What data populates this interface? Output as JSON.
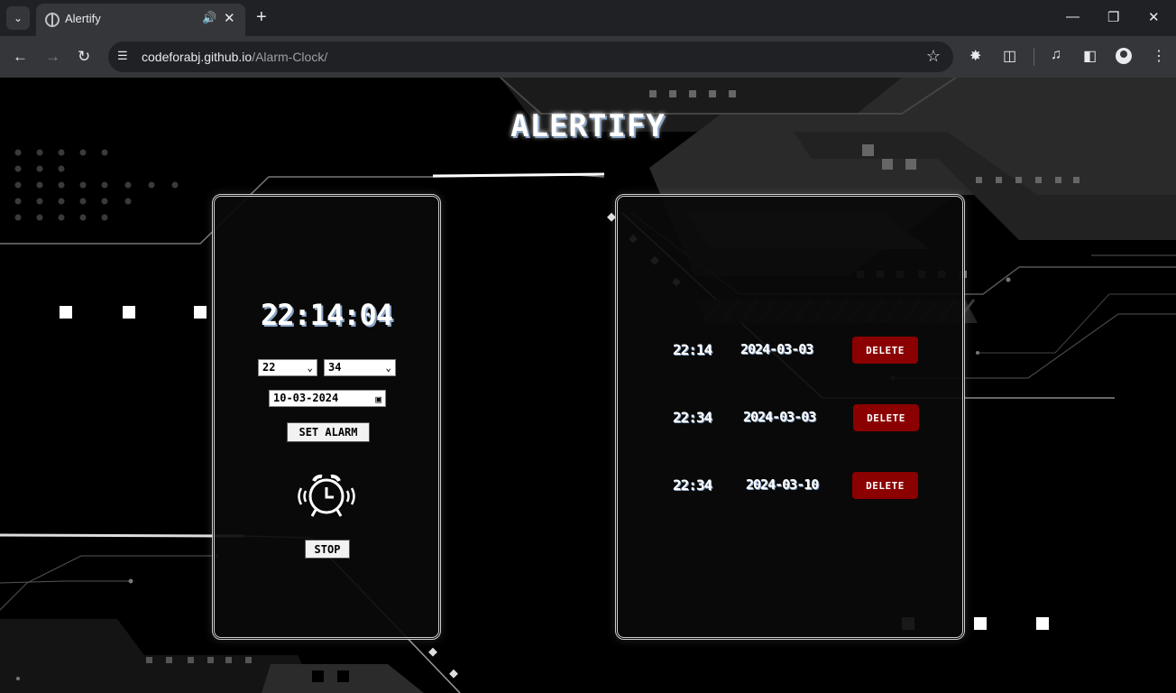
{
  "browser": {
    "tab_title": "Alertify",
    "url_host": "codeforabj.github.io",
    "url_path": "/Alarm-Clock/",
    "icons": [
      "tab-search-icon",
      "favicon-icon",
      "audio-icon",
      "close-icon",
      "new-tab-icon",
      "minimize-icon",
      "restore-icon",
      "window-close-icon",
      "back-icon",
      "forward-icon",
      "reload-icon",
      "site-info-icon",
      "bookmark-star-icon",
      "extension-icon",
      "puzzle-icon",
      "media-icon",
      "sidepanel-icon",
      "profile-icon",
      "menu-icon"
    ]
  },
  "app": {
    "title": "ALERTIFY",
    "clock": "22:14:04",
    "hour_value": "22",
    "minute_value": "34",
    "date_value": "10-03-2024",
    "set_alarm_label": "SET ALARM",
    "stop_label": "STOP",
    "icon": "alarm-clock-icon"
  },
  "alarms": [
    {
      "time": "22:14",
      "date": "2024-03-03",
      "delete_label": "DELETE"
    },
    {
      "time": "22:34",
      "date": "2024-03-03",
      "delete_label": "DELETE"
    },
    {
      "time": "22:34",
      "date": "2024-03-10",
      "delete_label": "DELETE"
    }
  ],
  "colors": {
    "accent_red": "#8b0000",
    "text_shadow": "#8aa6c8",
    "background": "#000000"
  }
}
